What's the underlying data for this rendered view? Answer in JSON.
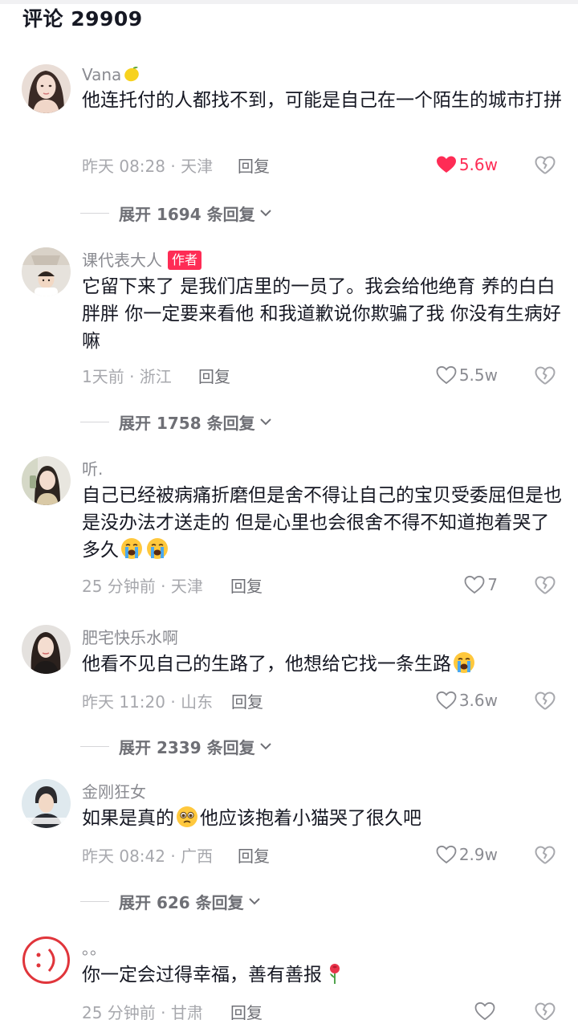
{
  "header": {
    "title": "评论 29909"
  },
  "comments": [
    {
      "username": "Vana",
      "content": "他连托付的人都找不到，可能是自己在一个陌生的城市打拼",
      "time": "昨天 08:28 · 天津",
      "reply_label": "回复",
      "likes": "5.6w",
      "liked": true,
      "expand": "展开 1694 条回复"
    },
    {
      "username": "课代表大人",
      "badge": "作者",
      "content": "它留下来了 是我们店里的一员了。我会给他绝育 养的白白胖胖 你一定要来看他 和我道歉说你欺骗了我 你没有生病好嘛",
      "time": "1天前 · 浙江",
      "reply_label": "回复",
      "likes": "5.5w",
      "liked": false,
      "expand": "展开 1758 条回复"
    },
    {
      "username": "听.",
      "content": "自己已经被病痛折磨但是舍不得让自己的宝贝受委屈但是也是没办法才送走的 但是心里也会很舍不得不知道抱着哭了多久",
      "time": "25 分钟前 · 天津",
      "reply_label": "回复",
      "likes": "7",
      "liked": false
    },
    {
      "username": "肥宅快乐水啊",
      "content": "他看不见自己的生路了，他想给它找一条生路",
      "time": "昨天 11:20 · 山东",
      "reply_label": "回复",
      "likes": "3.6w",
      "liked": false,
      "expand": "展开 2339 条回复"
    },
    {
      "username": "金刚狂女",
      "content_before": "如果是真的",
      "content_after": "他应该抱着小猫哭了很久吧",
      "time": "昨天 08:42 · 广西",
      "reply_label": "回复",
      "likes": "2.9w",
      "liked": false,
      "expand": "展开 626 条回复"
    },
    {
      "username": "。。",
      "content": "你一定会过得幸福，善有善报",
      "time": "25 分钟前 · 甘肃",
      "reply_label": "回复",
      "likes": "",
      "liked": false
    }
  ],
  "icons": {
    "like_filled": "heart-filled-icon",
    "like": "heart-outline-icon",
    "dislike": "broken-heart-icon",
    "expand": "chevron-down-icon",
    "emoji_lemon": "lemon-emoji",
    "emoji_cry": "loudly-crying-emoji",
    "emoji_plead": "pleading-face-emoji",
    "emoji_rose": "rose-emoji"
  },
  "colors": {
    "accent": "#fe2c55",
    "secondary_text": "#8a8b91"
  }
}
